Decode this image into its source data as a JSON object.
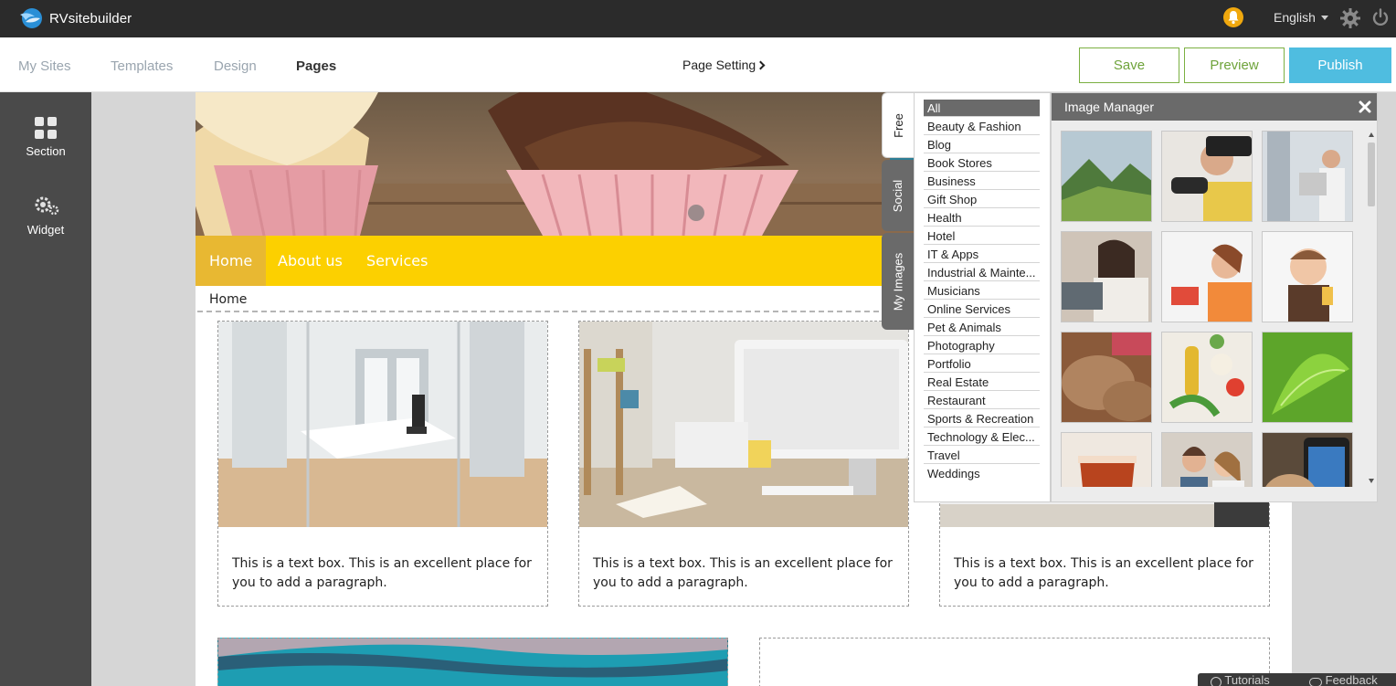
{
  "app": {
    "name": "RVsitebuilder",
    "language": "English"
  },
  "nav": {
    "items": [
      {
        "label": "My Sites",
        "active": false
      },
      {
        "label": "Templates",
        "active": false
      },
      {
        "label": "Design",
        "active": false
      },
      {
        "label": "Pages",
        "active": true
      }
    ],
    "page_setting": "Page Setting",
    "save": "Save",
    "preview": "Preview",
    "publish": "Publish"
  },
  "sidebar": {
    "section": "Section",
    "widget": "Widget"
  },
  "site": {
    "menu": [
      "Home",
      "About us",
      "Services"
    ],
    "breadcrumb": "Home",
    "card_text": "This is a text box. This is an excellent place for you to add a paragraph."
  },
  "image_manager": {
    "title": "Image Manager",
    "tabs": [
      "Free",
      "Social",
      "My Images"
    ],
    "categories": [
      "All",
      "Beauty & Fashion",
      "Blog",
      "Book Stores",
      "Business",
      "Gift Shop",
      "Health",
      "Hotel",
      "IT & Apps",
      "Industrial & Mainte...",
      "Musicians",
      "Online Services",
      "Pet & Animals",
      "Photography",
      "Portfolio",
      "Real Estate",
      "Restaurant",
      "Sports & Recreation",
      "Technology & Elec...",
      "Travel",
      "Weddings"
    ]
  },
  "footer": {
    "tutorials": "Tutorials",
    "feedback": "Feedback"
  },
  "colors": {
    "accent": "#4fbde0",
    "green": "#6ea33a",
    "menu_yellow": "#fcd000",
    "topbar": "#2b2b2b"
  }
}
